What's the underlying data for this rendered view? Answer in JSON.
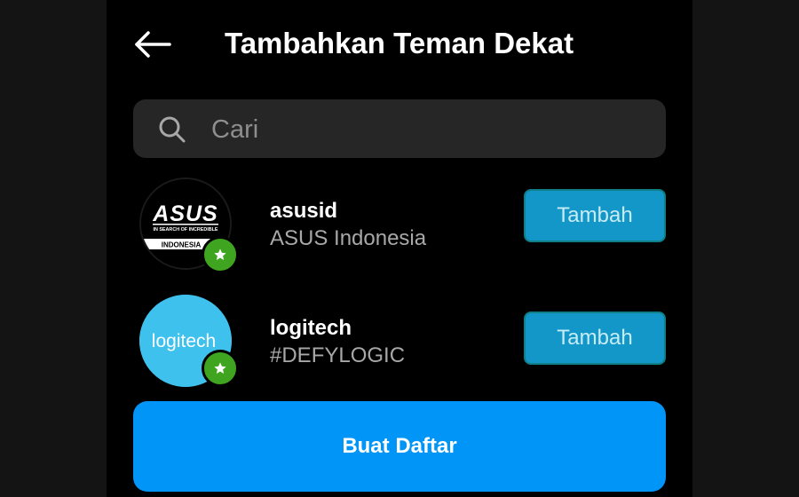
{
  "header": {
    "title": "Tambahkan Teman Dekat",
    "back_icon": "arrow-left-icon"
  },
  "search": {
    "placeholder": "Cari",
    "value": "",
    "icon": "search-icon"
  },
  "users": [
    {
      "username": "asusid",
      "full_name": "ASUS Indonesia",
      "add_label": "Tambah",
      "avatar_logo": {
        "brand": "ASUS",
        "tagline": "IN SEARCH OF INCREDIBLE",
        "region": "INDONESIA"
      },
      "badge_icon": "star-icon"
    },
    {
      "username": "logitech",
      "full_name": "#DEFYLOGIC",
      "add_label": "Tambah",
      "avatar_logo": {
        "brand": "logitech"
      },
      "badge_icon": "star-icon"
    }
  ],
  "footer": {
    "create_label": "Buat Daftar"
  },
  "colors": {
    "background": "#000000",
    "search_bg": "#262626",
    "primary_button": "#0095f6",
    "add_button": "#1297c8",
    "badge": "#3fa520",
    "logitech_blue": "#3fc1ee"
  }
}
